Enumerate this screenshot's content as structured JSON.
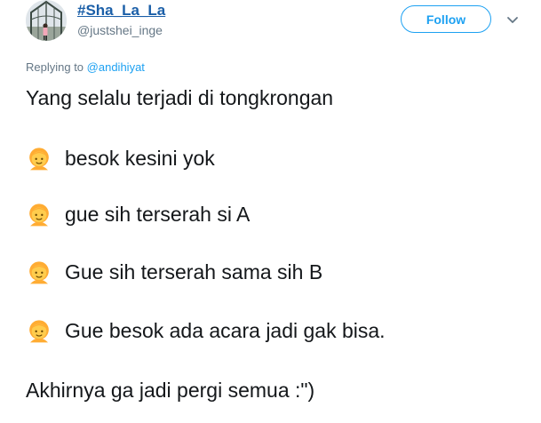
{
  "author": {
    "display_name": "#Sha_La_La",
    "handle": "@justshei_inge",
    "avatar_icon": "profile-photo"
  },
  "actions": {
    "follow_label": "Follow",
    "more_icon": "chevron-down-icon"
  },
  "reply": {
    "prefix": "Replying to",
    "mention": "@andihiyat"
  },
  "tweet": {
    "intro": "Yang selalu terjadi di tongkrongan",
    "dialogue": [
      {
        "emoji": "person-emoji",
        "text": "besok kesini yok"
      },
      {
        "emoji": "person-emoji",
        "text": "gue sih terserah si A"
      },
      {
        "emoji": "person-emoji",
        "text": "Gue sih terserah sama sih B"
      },
      {
        "emoji": "person-emoji",
        "text": "Gue besok ada acara jadi gak bisa."
      }
    ],
    "outro": "Akhirnya ga jadi pergi semua :\")"
  },
  "colors": {
    "link_blue": "#1da1f2",
    "name_blue": "#1b5fa8",
    "muted": "#657786",
    "text": "#14171a",
    "emoji_face": "#ffcc4d",
    "emoji_hair": "#ffac33"
  }
}
